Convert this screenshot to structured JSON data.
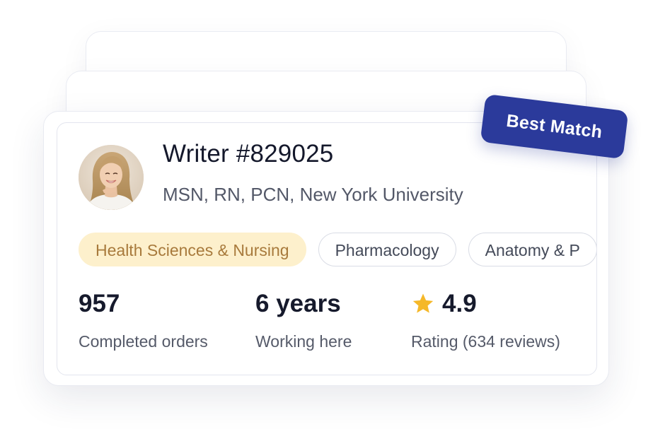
{
  "writer": {
    "name": "Writer #829025",
    "credentials": "MSN, RN, PCN, New York University"
  },
  "badge": {
    "label": "Best Match",
    "color": "#2b3a9b"
  },
  "tags": [
    {
      "label": "Health Sciences & Nursing",
      "style": "primary"
    },
    {
      "label": "Pharmacology",
      "style": "outline"
    },
    {
      "label": "Anatomy & P",
      "style": "outline"
    }
  ],
  "stats": {
    "orders": {
      "value": "957",
      "label": "Completed orders"
    },
    "experience": {
      "value": "6 years",
      "label": "Working here"
    },
    "rating": {
      "value": "4.9",
      "label": "Rating (634 reviews)",
      "icon": "star-icon"
    }
  },
  "colors": {
    "tag_primary_bg": "#fdf0cc",
    "tag_primary_text": "#a87a3c",
    "star": "#f5b829",
    "text_dark": "#14182b"
  }
}
